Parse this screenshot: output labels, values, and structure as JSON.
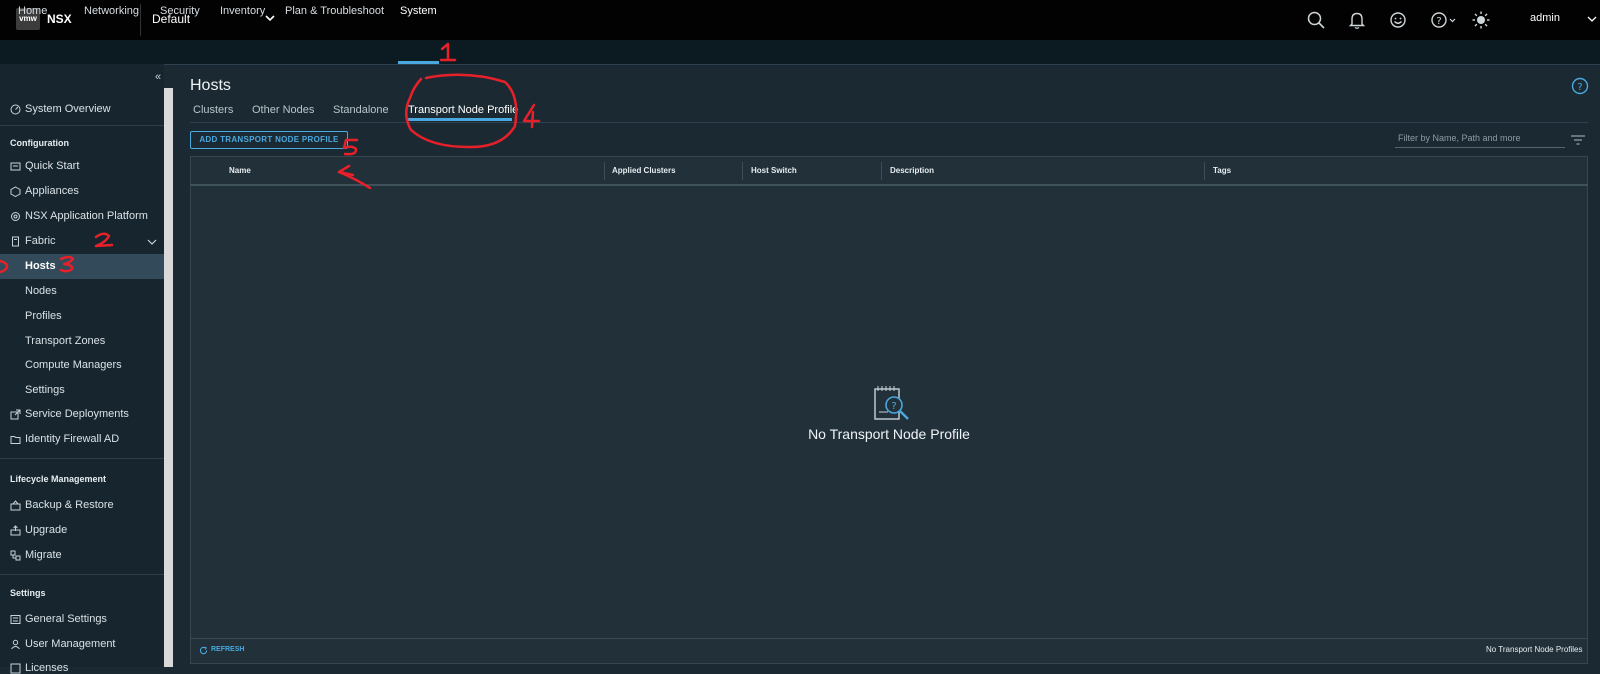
{
  "topbar": {
    "logo_text": "vmw",
    "app_name": "NSX",
    "context": "Default",
    "icons": [
      "search-icon",
      "bell-icon",
      "smiley-feedback-icon",
      "help-icon",
      "theme-sun-icon"
    ],
    "user": "admin"
  },
  "nav": {
    "items": [
      "Home",
      "Networking",
      "Security",
      "Inventory",
      "Plan & Troubleshoot",
      "System"
    ],
    "active": "System"
  },
  "sidebar": {
    "collapse": "«",
    "overview": "System Overview",
    "configuration": {
      "title": "Configuration",
      "items": [
        "Quick Start",
        "Appliances",
        "NSX Application Platform",
        "Fabric"
      ]
    },
    "fabric_children": [
      "Hosts",
      "Nodes",
      "Profiles",
      "Transport Zones",
      "Compute Managers",
      "Settings"
    ],
    "config_more": [
      "Service Deployments",
      "Identity Firewall AD"
    ],
    "lifecycle": {
      "title": "Lifecycle Management",
      "items": [
        "Backup & Restore",
        "Upgrade",
        "Migrate"
      ]
    },
    "settings": {
      "title": "Settings",
      "items": [
        "General Settings",
        "User Management",
        "Licenses"
      ]
    },
    "active_item": "Hosts"
  },
  "main": {
    "title": "Hosts",
    "tabs": [
      "Clusters",
      "Other Nodes",
      "Standalone",
      "Transport Node Profile"
    ],
    "active_tab": "Transport Node Profile",
    "add_button": "ADD TRANSPORT NODE PROFILE",
    "filter_placeholder": "Filter by Name, Path and more",
    "columns": [
      "Name",
      "Applied Clusters",
      "Host Switch",
      "Description",
      "Tags"
    ],
    "empty_message": "No Transport Node Profile",
    "refresh": "REFRESH",
    "footer_count": "No Transport Node Profiles"
  },
  "annotations": [
    "1",
    "2",
    "3",
    "4",
    "5"
  ],
  "colors": {
    "accent": "#4aa8e0",
    "annotation": "#e8202a",
    "topbar": "#020202",
    "main_bg": "#1b2a32"
  }
}
